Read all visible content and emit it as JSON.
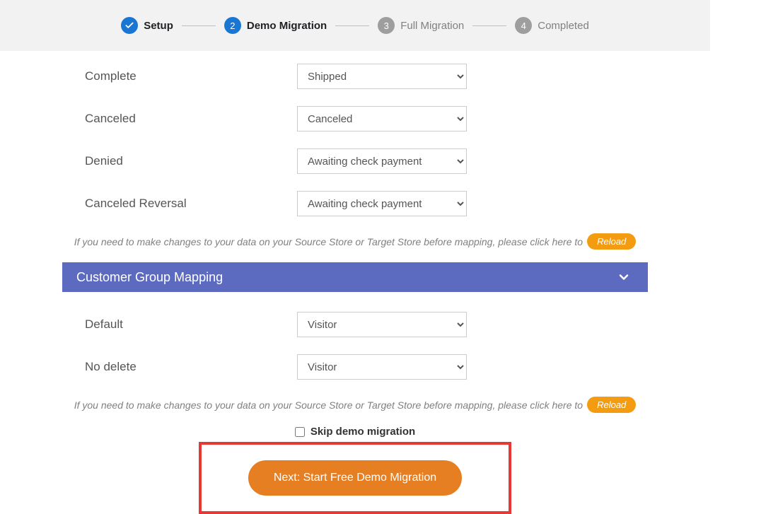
{
  "stepper": {
    "steps": [
      {
        "num": "✓",
        "label": "Setup",
        "state": "done"
      },
      {
        "num": "2",
        "label": "Demo Migration",
        "state": "active"
      },
      {
        "num": "3",
        "label": "Full Migration",
        "state": "pending"
      },
      {
        "num": "4",
        "label": "Completed",
        "state": "pending"
      }
    ]
  },
  "order_mapping": {
    "rows": [
      {
        "label": "Complete",
        "value": "Shipped"
      },
      {
        "label": "Canceled",
        "value": "Canceled"
      },
      {
        "label": "Denied",
        "value": "Awaiting check payment"
      },
      {
        "label": "Canceled Reversal",
        "value": "Awaiting check payment"
      }
    ]
  },
  "reload_hint": "If you need to make changes to your data on your Source Store or Target Store before mapping, please click here to",
  "reload_label": "Reload",
  "customer_group_header": "Customer Group Mapping",
  "customer_group_mapping": {
    "rows": [
      {
        "label": "Default",
        "value": "Visitor"
      },
      {
        "label": "No delete",
        "value": "Visitor"
      }
    ]
  },
  "skip_label": "Skip demo migration",
  "next_button": "Next: Start Free Demo Migration"
}
